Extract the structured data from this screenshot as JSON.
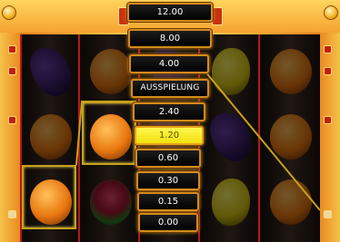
{
  "stake_menu": {
    "items": [
      {
        "label": "12.00",
        "selected": false
      },
      {
        "label": "8.00",
        "selected": false
      },
      {
        "label": "4.00",
        "selected": false
      },
      {
        "label": "AUSSPIELUNG",
        "selected": false
      },
      {
        "label": "2.40",
        "selected": false
      },
      {
        "label": "1.20",
        "selected": true
      },
      {
        "label": "0.60",
        "selected": false
      },
      {
        "label": "0.30",
        "selected": false
      },
      {
        "label": "0.15",
        "selected": false
      },
      {
        "label": "0.00",
        "selected": false
      }
    ]
  },
  "reels": {
    "symbols": [
      [
        "plum",
        "orange",
        "orange"
      ],
      [
        "orange",
        "orange",
        "melon"
      ],
      [
        "plum",
        "plum",
        "plum"
      ],
      [
        "lemon",
        "plum",
        "lemon"
      ],
      [
        "orange",
        "orange",
        "orange"
      ]
    ]
  },
  "colors": {
    "accent_gold": "#d48b1c",
    "selected_yellow": "#f2e10e",
    "reel_divider_red": "#b8161a",
    "win_line_gold": "#c7a21a"
  }
}
